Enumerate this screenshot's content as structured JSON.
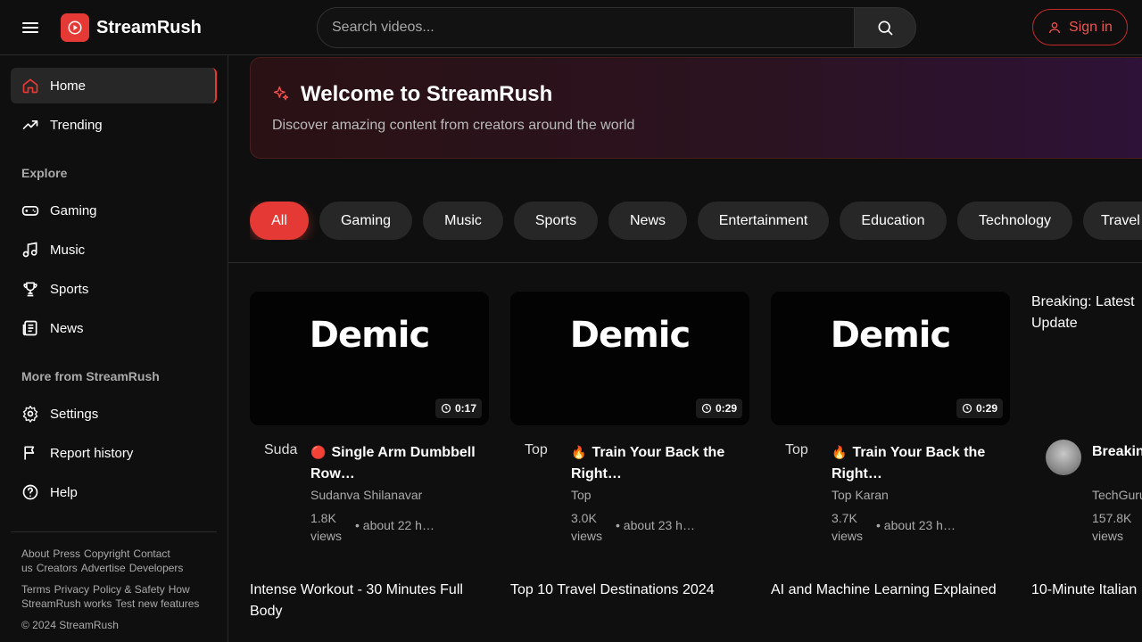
{
  "header": {
    "logo_text": "StreamRush",
    "search_placeholder": "Search videos...",
    "signin_label": "Sign in"
  },
  "sidebar": {
    "primary": [
      {
        "label": "Home",
        "icon": "home-icon",
        "active": true
      },
      {
        "label": "Trending",
        "icon": "trending-icon"
      }
    ],
    "explore_title": "Explore",
    "explore": [
      {
        "label": "Gaming",
        "icon": "gamepad-icon"
      },
      {
        "label": "Music",
        "icon": "music-note-icon"
      },
      {
        "label": "Sports",
        "icon": "trophy-icon"
      },
      {
        "label": "News",
        "icon": "newspaper-icon"
      }
    ],
    "more_title": "More from StreamRush",
    "more": [
      {
        "label": "Settings",
        "icon": "gear-icon"
      },
      {
        "label": "Report history",
        "icon": "flag-icon"
      },
      {
        "label": "Help",
        "icon": "help-circle-icon"
      }
    ],
    "footer": {
      "row1": [
        "About",
        "Press",
        "Copyright",
        "Contact us",
        "Creators",
        "Advertise",
        "Developers"
      ],
      "row2": [
        "Terms",
        "Privacy",
        "Policy & Safety",
        "How StreamRush works",
        "Test new features"
      ],
      "copyright": "© 2024 StreamRush"
    }
  },
  "welcome": {
    "title": "Welcome to StreamRush",
    "subtitle": "Discover amazing content from creators around the world"
  },
  "chips": [
    "All",
    "Gaming",
    "Music",
    "Sports",
    "News",
    "Entertainment",
    "Education",
    "Technology",
    "Travel"
  ],
  "videos": [
    {
      "thumb_text": "Demic",
      "duration": "0:17",
      "avatar_alt": "Suda",
      "emoji": "🔴",
      "title": "Single Arm Dumbbell Row…",
      "channel": "Sudanva Shilanavar",
      "views": "1.8K views",
      "time": "• about 22 h…"
    },
    {
      "thumb_text": "Demic",
      "duration": "0:29",
      "avatar_alt": "Top",
      "emoji": "🔥",
      "title": "Train Your Back the Right…",
      "channel": "Top",
      "views": "3.0K views",
      "time": "• about 23 h…"
    },
    {
      "thumb_text": "Demic",
      "duration": "0:29",
      "avatar_alt": "Top",
      "emoji": "🔥",
      "title": "Train Your Back the Right…",
      "channel": "Top Karan",
      "views": "3.7K views",
      "time": "• about 23 h…"
    },
    {
      "thumb_alt": "Breaking: Latest Update",
      "title": "Breaking Tech News",
      "channel": "TechGuru",
      "views": "157.8K views"
    }
  ],
  "row2_thumbs": [
    "Intense Workout - 30 Minutes Full Body",
    "Top 10 Travel Destinations 2024",
    "AI and Machine Learning Explained",
    "10-Minute Italian"
  ],
  "colors": {
    "accent": "#e53935",
    "background": "#0f0f0f",
    "surface": "#272727"
  }
}
